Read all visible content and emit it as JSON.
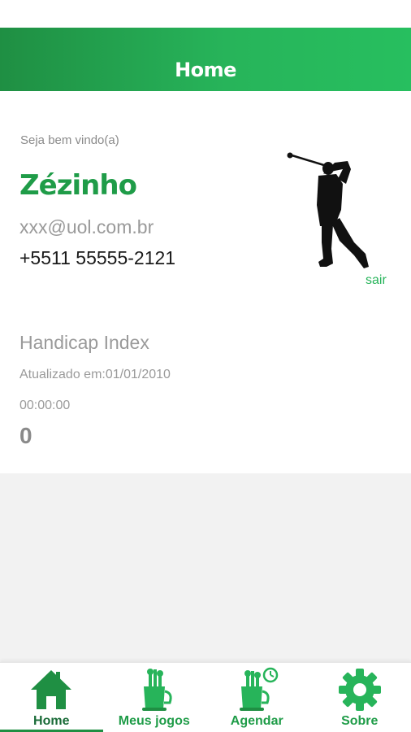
{
  "header": {
    "title": "Home"
  },
  "profile": {
    "welcome": "Seja bem vindo(a)",
    "name": "Zézinho",
    "email": "xxx@uol.com.br",
    "phone": "+5511 55555-2121",
    "logout_label": "sair"
  },
  "handicap": {
    "title": "Handicap Index",
    "updated": "Atualizado em:01/01/2010",
    "time": "00:00:00",
    "value": "0"
  },
  "nav": {
    "items": [
      {
        "label": "Home",
        "icon": "home-icon",
        "active": true
      },
      {
        "label": "Meus jogos",
        "icon": "golf-bag-icon",
        "active": false
      },
      {
        "label": "Agendar",
        "icon": "golf-bag-clock-icon",
        "active": false
      },
      {
        "label": "Sobre",
        "icon": "gear-icon",
        "active": false
      }
    ]
  },
  "colors": {
    "brand": "#27b45a",
    "brand_dark": "#1f8f43",
    "text_muted": "#9a9a9a",
    "background_empty": "#f2f2f2"
  }
}
